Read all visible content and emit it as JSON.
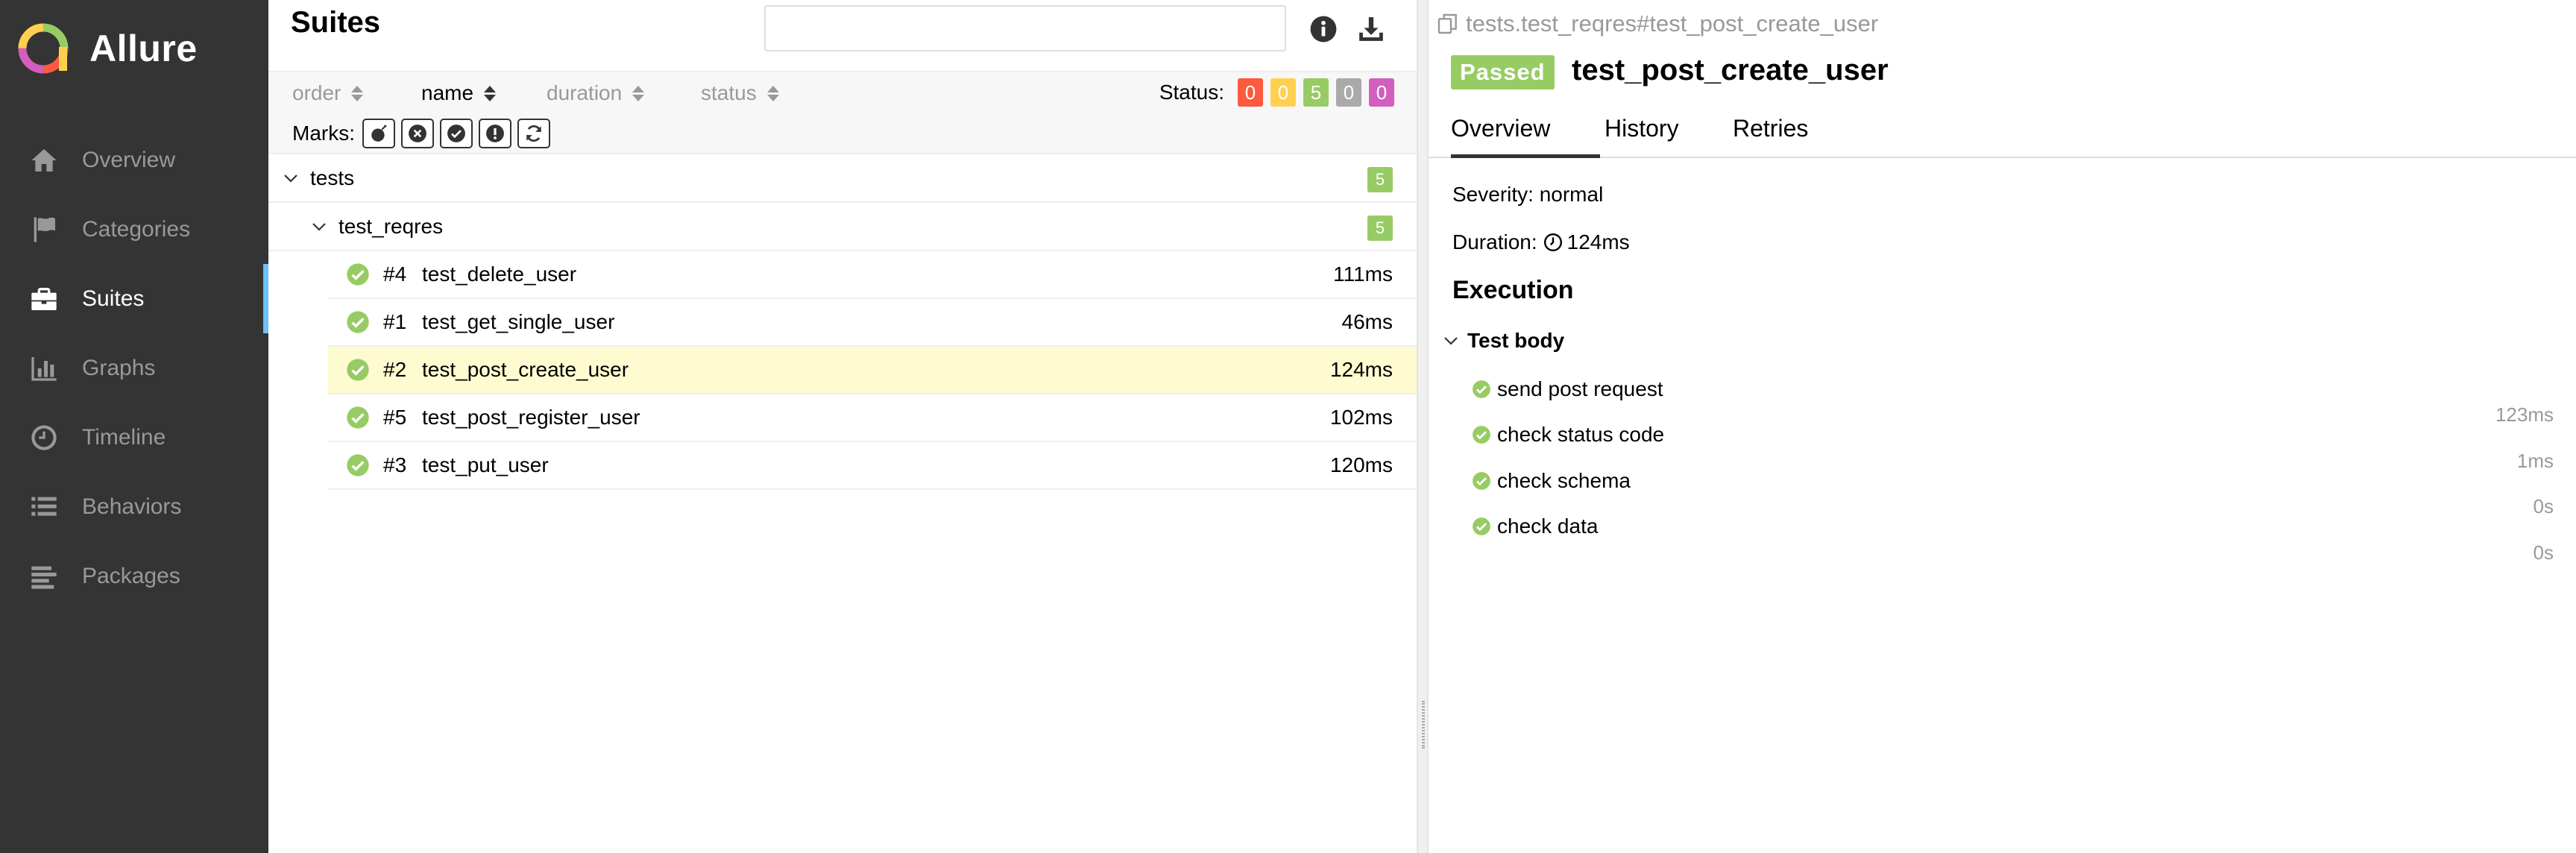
{
  "app": {
    "name": "Allure"
  },
  "sidebar": {
    "items": [
      {
        "label": "Overview",
        "icon": "home-icon"
      },
      {
        "label": "Categories",
        "icon": "flag-icon"
      },
      {
        "label": "Suites",
        "icon": "briefcase-icon",
        "active": true
      },
      {
        "label": "Graphs",
        "icon": "bar-chart-icon"
      },
      {
        "label": "Timeline",
        "icon": "clock-icon"
      },
      {
        "label": "Behaviors",
        "icon": "list-icon"
      },
      {
        "label": "Packages",
        "icon": "align-left-icon"
      }
    ]
  },
  "suites": {
    "title": "Suites",
    "search_value": "",
    "sort": {
      "order": "order",
      "name": "name",
      "duration": "duration",
      "status": "status"
    },
    "status_label": "Status:",
    "status_counts": [
      {
        "name": "failed",
        "count": "0",
        "color": "#fd5a3e"
      },
      {
        "name": "broken",
        "count": "0",
        "color": "#ffd050"
      },
      {
        "name": "passed",
        "count": "5",
        "color": "#97cc64"
      },
      {
        "name": "skipped",
        "count": "0",
        "color": "#aaaaaa"
      },
      {
        "name": "unknown",
        "count": "0",
        "color": "#d35ebe"
      }
    ],
    "marks_label": "Marks:",
    "tree": {
      "root": {
        "label": "tests",
        "count": "5"
      },
      "child": {
        "label": "test_reqres",
        "count": "5"
      },
      "tests": [
        {
          "num": "#4",
          "name": "test_delete_user",
          "duration": "111ms"
        },
        {
          "num": "#1",
          "name": "test_get_single_user",
          "duration": "46ms"
        },
        {
          "num": "#2",
          "name": "test_post_create_user",
          "duration": "124ms",
          "selected": true
        },
        {
          "num": "#5",
          "name": "test_post_register_user",
          "duration": "102ms"
        },
        {
          "num": "#3",
          "name": "test_put_user",
          "duration": "120ms"
        }
      ]
    }
  },
  "detail": {
    "breadcrumb": "tests.test_reqres#test_post_create_user",
    "status": "Passed",
    "title": "test_post_create_user",
    "tabs": [
      "Overview",
      "History",
      "Retries"
    ],
    "severity": "Severity: normal",
    "duration_label": "Duration:",
    "duration_value": "124ms",
    "execution_title": "Execution",
    "test_body_label": "Test body",
    "steps": [
      {
        "name": "send post request",
        "duration": "123ms"
      },
      {
        "name": "check status code",
        "duration": "1ms"
      },
      {
        "name": "check schema",
        "duration": "0s"
      },
      {
        "name": "check data",
        "duration": "0s"
      }
    ]
  },
  "colors": {
    "sidebar_bg": "#343434",
    "passed": "#97cc64",
    "selected_row": "#fffbd0",
    "active_accent": "#6bc0ff"
  }
}
